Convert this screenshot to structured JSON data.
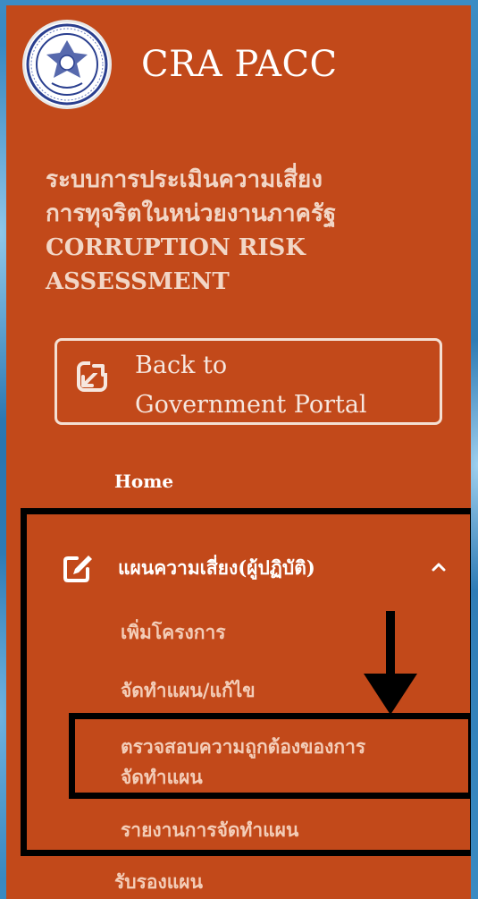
{
  "brand": {
    "name": "CRA PACC",
    "logo_icon": "pacc-seal-logo"
  },
  "system_title": {
    "line1": "ระบบการประเมินความเสี่ยง",
    "line2": "การทุจริตในหน่วยงานภาครัฐ",
    "line3": "CORRUPTION RISK",
    "line4": "ASSESSMENT"
  },
  "portal_button": {
    "line1": "Back to",
    "line2": "Government Portal",
    "icon": "external-link-icon"
  },
  "nav": {
    "home": "Home",
    "group": {
      "label": "แผนความเสี่ยง(ผู้ปฏิบัติ)",
      "icon": "edit-icon",
      "expanded_icon": "chevron-up-icon",
      "items": [
        "เพิ่มโครงการ",
        "จัดทำแผน/แก้ไข",
        "ตรวจสอบความถูกต้องของการจัดทำแผน",
        "รายงานการจัดทำแผน"
      ],
      "item3_line1": "ตรวจสอบความถูกต้องของการ",
      "item3_line2": "จัดทำแผน"
    },
    "next_item": "รับรองแผน"
  },
  "colors": {
    "panel": "#c2491a",
    "highlight": "#000000",
    "background": "#2f7fb8"
  }
}
